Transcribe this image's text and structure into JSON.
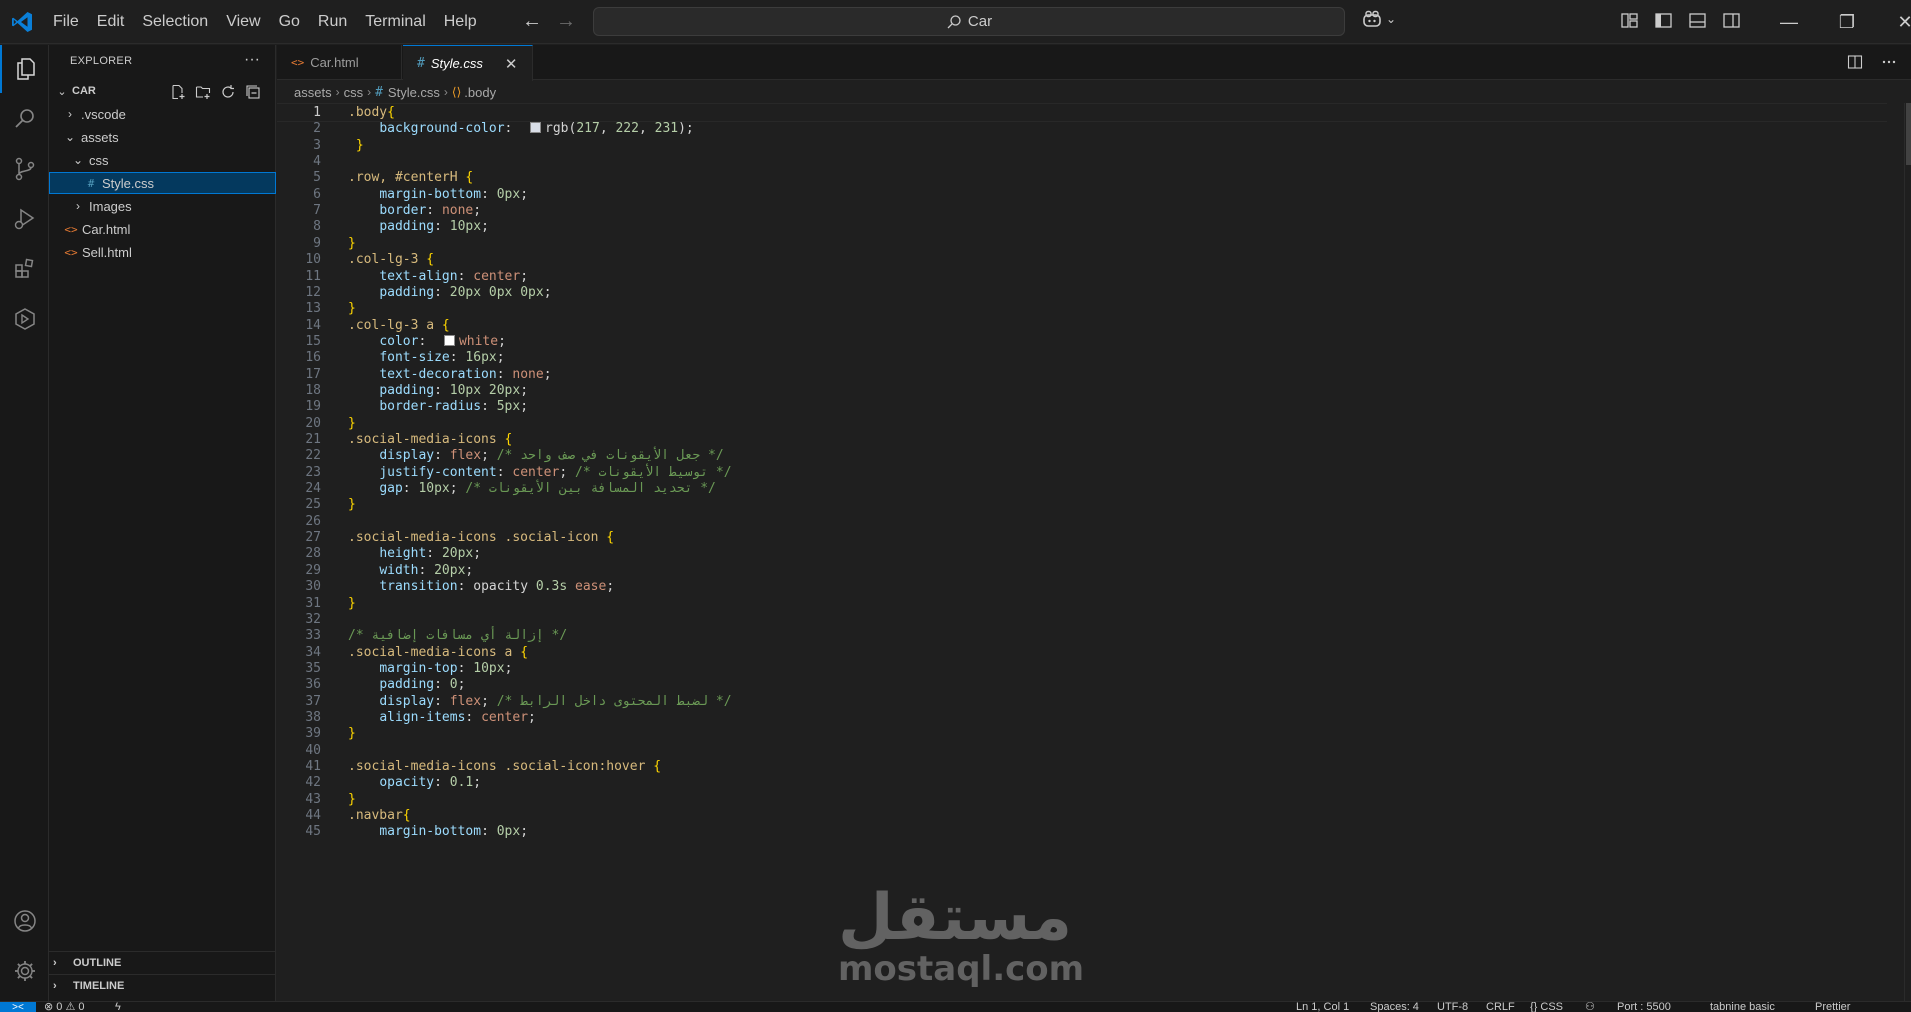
{
  "window": {
    "menu": [
      "File",
      "Edit",
      "Selection",
      "View",
      "Go",
      "Run",
      "Terminal",
      "Help"
    ],
    "search_text": "Car",
    "accent_color": "#0078d4"
  },
  "explorer": {
    "title": "EXPLORER",
    "more": "···",
    "root": "CAR",
    "tree": [
      {
        "label": ".vscode",
        "type": "folder",
        "expanded": false
      },
      {
        "label": "assets",
        "type": "folder",
        "expanded": true
      },
      {
        "label": "css",
        "type": "folder",
        "expanded": true
      },
      {
        "label": "Style.css",
        "type": "css",
        "selected": true
      },
      {
        "label": "Images",
        "type": "folder",
        "expanded": false
      },
      {
        "label": "Car.html",
        "type": "html"
      },
      {
        "label": "Sell.html",
        "type": "html"
      }
    ],
    "outline": "OUTLINE",
    "timeline": "TIMELINE"
  },
  "tabs": [
    {
      "label": "Car.html",
      "icon": "html-icon",
      "active": false
    },
    {
      "label": "Style.css",
      "icon": "css-icon",
      "active": true
    }
  ],
  "breadcrumb": [
    "assets",
    "css",
    "Style.css",
    ".body"
  ],
  "code_lines": [
    ".body{",
    "    background-color:  rgb(217, 222, 231);",
    " }",
    "",
    ".row, #centerH {",
    "    margin-bottom: 0px;",
    "    border: none;",
    "    padding: 10px;",
    "}",
    ".col-lg-3 {",
    "    text-align: center;",
    "    padding: 20px 0px 0px;",
    "}",
    ".col-lg-3 a {",
    "    color:  white;",
    "    font-size: 16px;",
    "    text-decoration: none;",
    "    padding: 10px 20px;",
    "    border-radius: 5px;",
    "}",
    ".social-media-icons {",
    "    display: flex; /* جعل الأيقونات في صف واحد */",
    "    justify-content: center; /* توسيط الأيقونات */",
    "    gap: 10px; /* تحديد المسافة بين الأيقونات */",
    "}",
    "",
    ".social-media-icons .social-icon {",
    "    height: 20px;",
    "    width: 20px;",
    "    transition: opacity 0.3s ease;",
    "}",
    "",
    "/* إزالة أي مسافات إضافية */",
    ".social-media-icons a {",
    "    margin-top: 10px;",
    "    padding: 0;",
    "    display: flex; /* لضبط المحتوى داخل الرابط */",
    "    align-items: center;",
    "}",
    "",
    ".social-media-icons .social-icon:hover {",
    "    opacity: 0.1;",
    "}",
    ".navbar{",
    "    margin-bottom: 0px;"
  ],
  "watermark": {
    "arabic": "مستقل",
    "latin": "mostaql.com"
  },
  "status": {
    "remote": "><",
    "problems": "⊗ 0 ⚠ 0",
    "position": "Ln 1, Col 1",
    "spaces": "Spaces: 4",
    "encoding": "UTF-8",
    "eol": "CRLF",
    "language": "{} CSS",
    "port": "Port : 5500",
    "tabnine": "tabnine basic",
    "prettier": "Prettier"
  }
}
